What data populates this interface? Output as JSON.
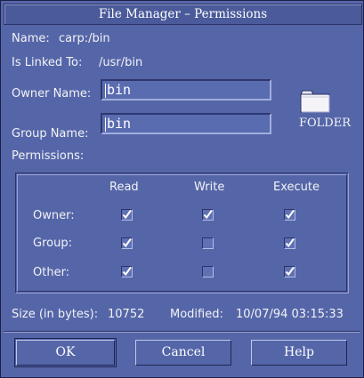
{
  "window": {
    "title": "File Manager – Permissions"
  },
  "info": {
    "name_label": "Name:",
    "name_value": "carp:/bin",
    "linked_label": "Is Linked To:",
    "linked_value": "/usr/bin"
  },
  "owner": {
    "label": "Owner Name:",
    "value": "bin"
  },
  "group": {
    "label": "Group Name:",
    "value": "bin"
  },
  "icon": {
    "name": "folder-icon",
    "label": "FOLDER"
  },
  "permissions": {
    "label": "Permissions:",
    "columns": [
      "Read",
      "Write",
      "Execute"
    ],
    "rows": [
      {
        "label": "Owner:",
        "read": true,
        "write": true,
        "execute": true
      },
      {
        "label": "Group:",
        "read": true,
        "write": false,
        "execute": true
      },
      {
        "label": "Other:",
        "read": true,
        "write": false,
        "execute": true
      }
    ]
  },
  "size": {
    "label": "Size (in bytes):",
    "value": "10752"
  },
  "modified": {
    "label": "Modified:",
    "value": "10/07/94 03:15:33"
  },
  "buttons": {
    "ok": "OK",
    "cancel": "Cancel",
    "help": "Help"
  },
  "colors": {
    "background": "#5566a8",
    "check": "#ffffff"
  }
}
